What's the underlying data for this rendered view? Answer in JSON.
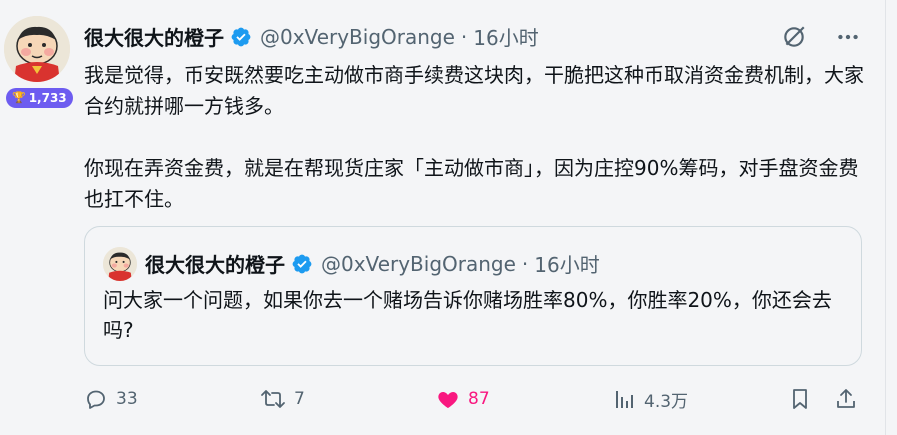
{
  "author": {
    "name": "很大很大的橙子",
    "handle": "@0xVeryBigOrange",
    "dot": "·",
    "time": "16小时",
    "badge_count": "1,733"
  },
  "tweet": {
    "text": "我是觉得，币安既然要吃主动做市商手续费这块肉，干脆把这种币取消资金费机制，大家合约就拼哪一方钱多。\n\n你现在弄资金费，就是在帮现货庄家「主动做市商」，因为庄控90%筹码，对手盘资金费也扛不住。"
  },
  "quote": {
    "name": "很大很大的橙子",
    "handle": "@0xVeryBigOrange",
    "dot": "·",
    "time": "16小时",
    "text": "问大家一个问题，如果你去一个赌场告诉你赌场胜率80%，你胜率20%，你还会去吗?"
  },
  "actions": {
    "replies": "33",
    "retweets": "7",
    "likes": "87",
    "views": "4.3万"
  },
  "colors": {
    "like": "#f91880",
    "verified": "#1d9bf0",
    "muted": "#536471",
    "badge": "#6d5cf0"
  },
  "icons": [
    "reply-icon",
    "retweet-icon",
    "heart-icon",
    "views-icon",
    "bookmark-icon",
    "share-icon",
    "grok-icon",
    "more-icon",
    "verified-icon",
    "trophy-icon"
  ]
}
